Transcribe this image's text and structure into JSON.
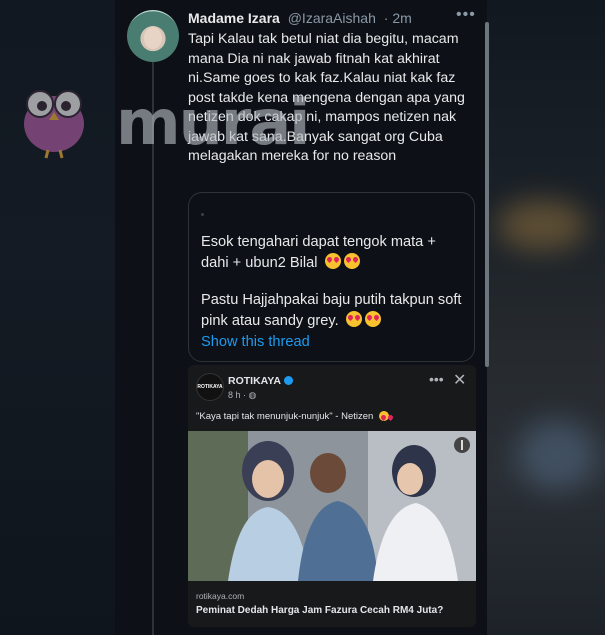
{
  "tweet": {
    "author_name": "Madame Izara",
    "handle": "@IzaraAishah",
    "time": "· 2m",
    "more": "•••",
    "text": "Tapi Kalau tak betul niat dia begitu, macam mana Dia ni nak jawab fitnah kat akhirat ni.Same goes to kak faz.Kalau niat kak faz  post takde kena mengena dengan apa yang netizen dok cakap ni, mampos netizen nak jawab kat sana.Banyak sangat org Cuba melagakan mereka for no reason"
  },
  "watermark": {
    "text": "murai"
  },
  "quote": {
    "paragraph1": "Esok tengahari dapat tengok mata + dahi + ubun2 Bilal",
    "paragraph2": "Pastu Hajjahpakai baju putih takpun soft pink atau sandy grey.",
    "show_thread": "Show this thread"
  },
  "facebook_post": {
    "page_logo": "ROTIKAYA",
    "page_name": "ROTIKAYA",
    "time": "8 h · ",
    "more": "•••",
    "close": "✕",
    "caption": "\"Kaya tapi tak menunjuk-nunjuk\" - Netizen",
    "domain": "rotikaya.com",
    "headline": "Peminat Dedah Harga Jam Fazura Cecah RM4 Juta?"
  },
  "colors": {
    "background": "#0d1117",
    "link": "#1d9bf0",
    "text": "#e7e9ea",
    "muted": "#8b98a5"
  }
}
